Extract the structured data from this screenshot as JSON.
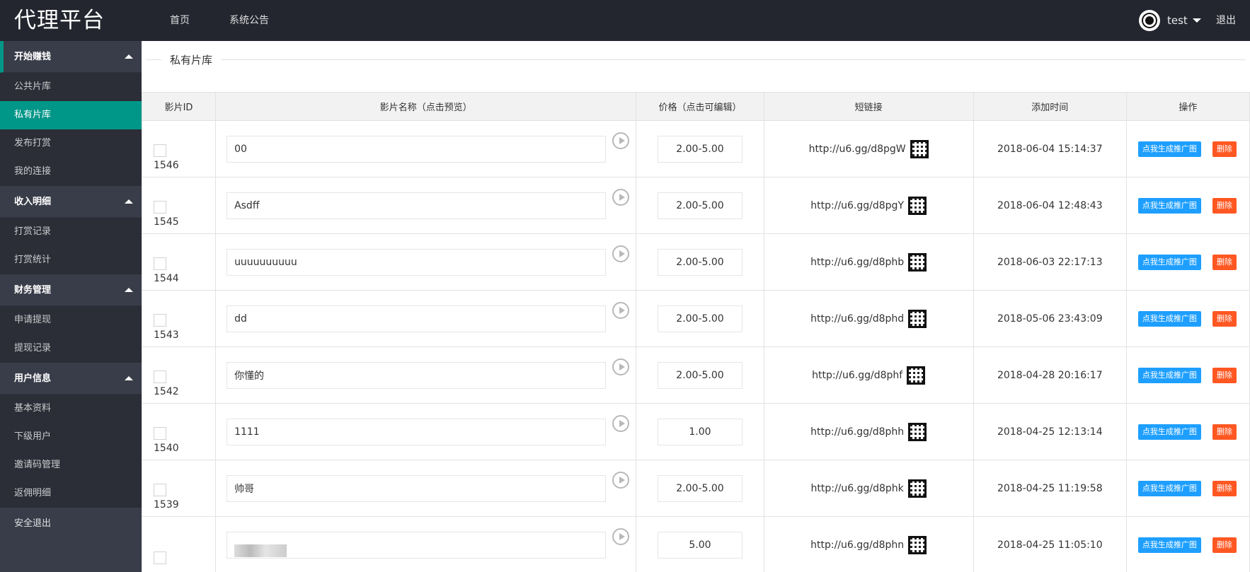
{
  "header": {
    "logo": "代理平台",
    "nav": [
      {
        "label": "首页"
      },
      {
        "label": "系统公告"
      }
    ],
    "username": "test",
    "logout": "退出"
  },
  "sidebar": {
    "groups": [
      {
        "label": "开始赚钱",
        "items": [
          "公共片库",
          "私有片库",
          "发布打赏",
          "我的连接"
        ]
      },
      {
        "label": "收入明细",
        "items": [
          "打赏记录",
          "打赏统计"
        ]
      },
      {
        "label": "财务管理",
        "items": [
          "申请提现",
          "提现记录"
        ]
      },
      {
        "label": "用户信息",
        "items": [
          "基本资料",
          "下级用户",
          "邀请码管理",
          "返佣明细"
        ]
      }
    ],
    "active_item": "私有片库",
    "bottom": "安全退出"
  },
  "main": {
    "section_title": "私有片库",
    "columns": [
      "影片ID",
      "影片名称（点击预览）",
      "价格（点击可编辑）",
      "短链接",
      "添加时间",
      "操作"
    ],
    "generate_label": "点我生成推广图",
    "delete_label": "删除",
    "rows": [
      {
        "id": "1546",
        "name": "00",
        "price": "2.00-5.00",
        "link": "http://u6.gg/d8pgW",
        "time": "2018-06-04 15:14:37"
      },
      {
        "id": "1545",
        "name": "Asdff",
        "price": "2.00-5.00",
        "link": "http://u6.gg/d8pgY",
        "time": "2018-06-04 12:48:43"
      },
      {
        "id": "1544",
        "name": "uuuuuuuuuu",
        "price": "2.00-5.00",
        "link": "http://u6.gg/d8phb",
        "time": "2018-06-03 22:17:13"
      },
      {
        "id": "1543",
        "name": "dd",
        "price": "2.00-5.00",
        "link": "http://u6.gg/d8phd",
        "time": "2018-05-06 23:43:09"
      },
      {
        "id": "1542",
        "name": "你懂的",
        "price": "2.00-5.00",
        "link": "http://u6.gg/d8phf",
        "time": "2018-04-28 20:16:17"
      },
      {
        "id": "1540",
        "name": "1111",
        "price": "1.00",
        "link": "http://u6.gg/d8phh",
        "time": "2018-04-25 12:13:14"
      },
      {
        "id": "1539",
        "name": "帅哥",
        "price": "2.00-5.00",
        "link": "http://u6.gg/d8phk",
        "time": "2018-04-25 11:19:58"
      },
      {
        "id": "",
        "name": "",
        "price": "5.00",
        "link": "http://u6.gg/d8phn",
        "time": "2018-04-25 11:05:10"
      }
    ]
  }
}
